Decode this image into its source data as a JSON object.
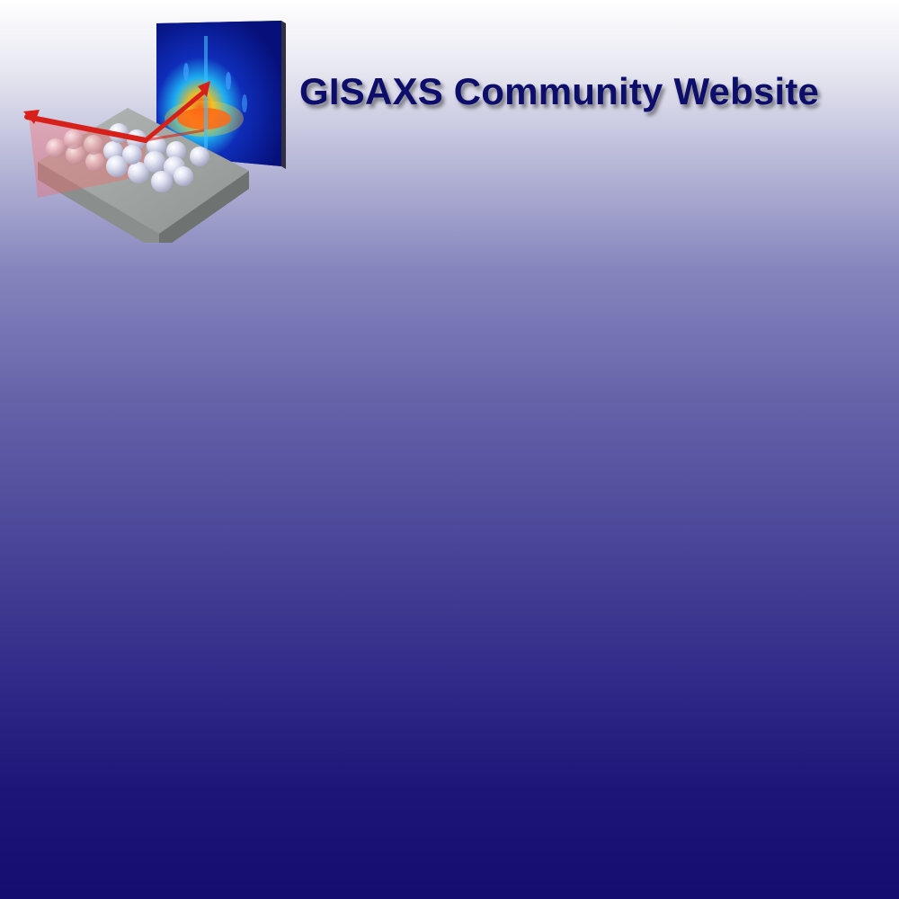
{
  "header": {
    "title": "GISAXS Community Website"
  },
  "logo": {
    "icon": "gisaxs-scattering-illustration-icon",
    "detector_color": "#0a1a9a",
    "beam_color": "#e0201a",
    "substrate_color": "#9a9f9c"
  }
}
